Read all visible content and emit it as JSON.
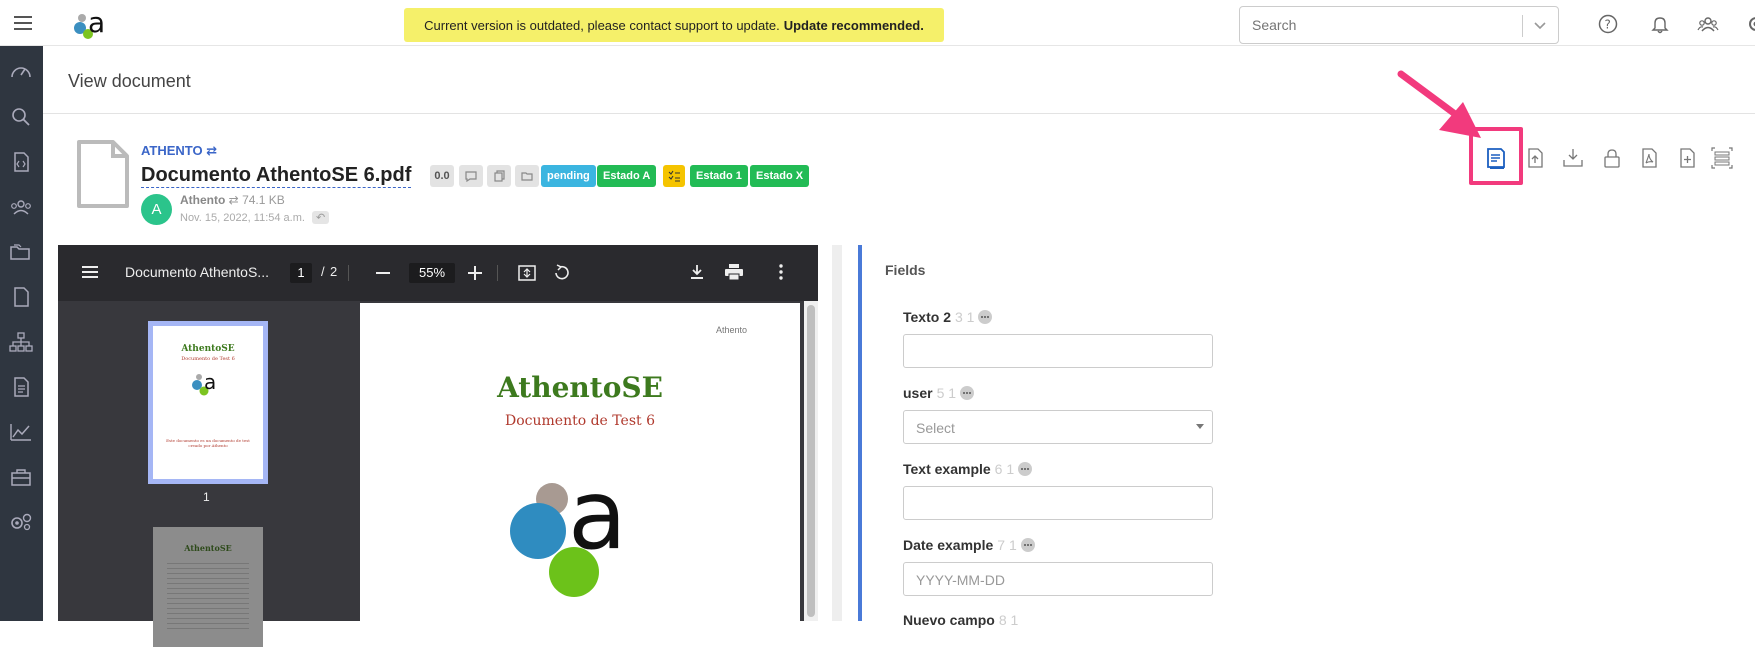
{
  "banner": {
    "text": "Current version is outdated, please contact support to update.",
    "strong": "Update recommended."
  },
  "search": {
    "placeholder": "Search"
  },
  "page": {
    "title": "View document"
  },
  "document": {
    "owner": "ATHENTO",
    "title": "Documento AthentoSE 6.pdf",
    "version": "0.0",
    "badges": [
      "pending",
      "Estado A",
      "Estado 1",
      "Estado X"
    ],
    "badge_colors": {
      "pending": "#3bb5e0",
      "green": "#22bb55",
      "yellow": "#f5c400"
    },
    "author_initial": "A",
    "author": "Athento",
    "size": "74.1 KB",
    "date": "Nov. 15, 2022, 11:54 a.m."
  },
  "viewer": {
    "doc_name": "Documento AthentoS...",
    "page_current": "1",
    "page_sep": "/",
    "page_total": "2",
    "zoom": "55%",
    "thumb1_label": "1",
    "page_header": "Athento",
    "page_title": "AthentoSE",
    "page_subtitle": "Documento de Test 6",
    "thumb_title": "AthentoSE",
    "thumb_subtitle": "Documento de Test 6",
    "thumb_body": "Este documento es un documento de test creado por Athento"
  },
  "fields": {
    "title": "Fields",
    "items": [
      {
        "label": "Texto 2",
        "meta": "3 1",
        "value": ""
      },
      {
        "label": "user",
        "meta": "5 1",
        "value": "Select"
      },
      {
        "label": "Text example",
        "meta": "6 1",
        "value": ""
      },
      {
        "label": "Date example",
        "meta": "7 1",
        "value": "YYYY-MM-DD"
      },
      {
        "label": "Nuevo campo",
        "meta": "8 1",
        "value": ""
      }
    ]
  },
  "colors": {
    "accent": "#3b66c8",
    "highlight": "#f23a7d",
    "sidebar": "#2f3640"
  }
}
